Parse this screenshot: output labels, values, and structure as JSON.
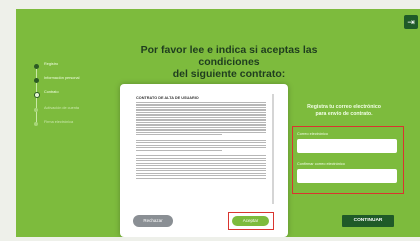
{
  "header": {
    "logout_icon": "exit-icon",
    "title_line1": "Por favor lee e indica si aceptas las condiciones",
    "title_line2": "del siguiente contrato:"
  },
  "steps": [
    {
      "label": "Registro",
      "state": "done"
    },
    {
      "label": "Información personal",
      "state": "done"
    },
    {
      "label": "Contrato",
      "state": "current"
    },
    {
      "label": "Activación de cuenta",
      "state": "future"
    },
    {
      "label": "Firma electrónica",
      "state": "future"
    }
  ],
  "contract": {
    "title": "CONTRATO DE ALTA DE USUARIO",
    "reject_label": "Rechazar",
    "accept_label": "Aceptar"
  },
  "registration": {
    "title_line1": "Registra tu correo electrónico",
    "title_line2": "para envío de contrato.",
    "email_label": "Correo electrónico",
    "email_value": "",
    "confirm_label": "Confirmar correo electrónico",
    "confirm_value": ""
  },
  "continue_label": "CONTINUAR",
  "colors": {
    "background": "#7dbb3d",
    "dark_green": "#1f5a28",
    "highlight": "#d9352f"
  }
}
